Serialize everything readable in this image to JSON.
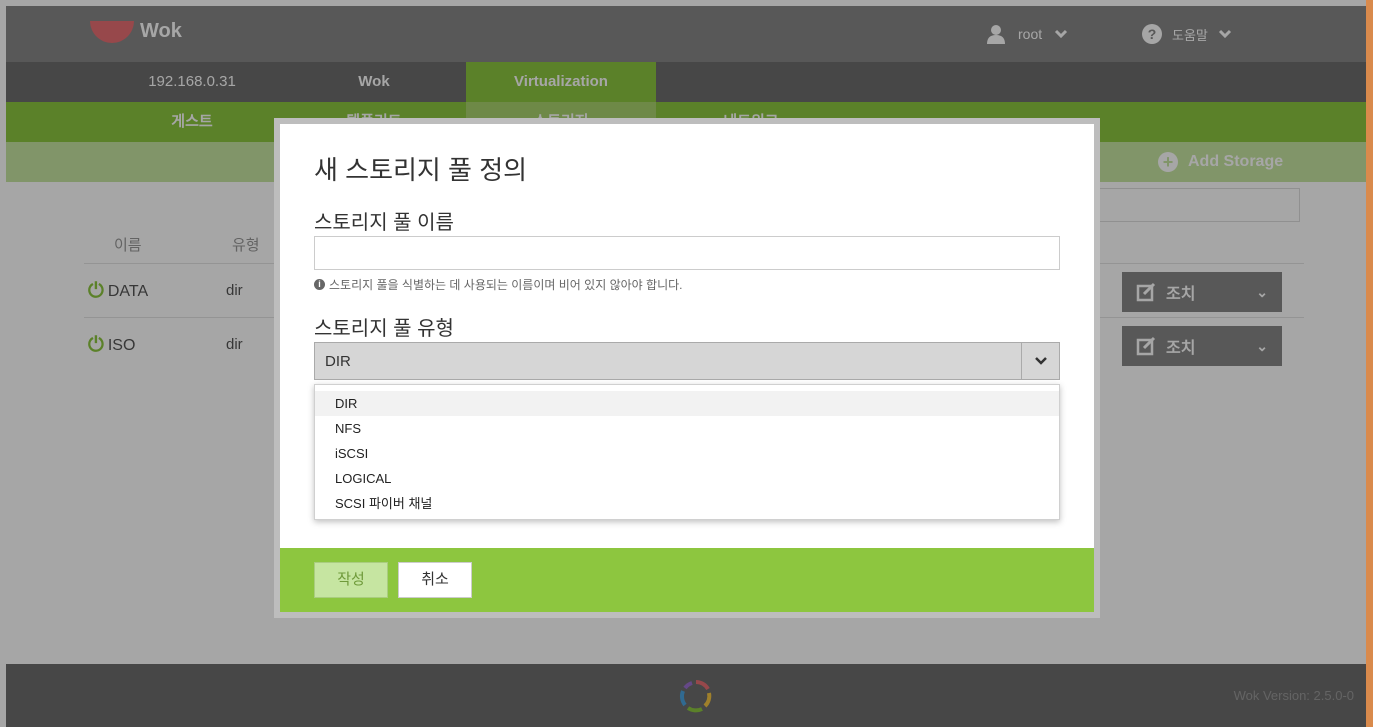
{
  "app": {
    "logo_text": "Wok"
  },
  "topbar": {
    "user": "root",
    "help": "도움말"
  },
  "host_tabs": [
    {
      "label": "192.168.0.31"
    },
    {
      "label": "Wok"
    },
    {
      "label": "Virtualization"
    }
  ],
  "sub_tabs": [
    {
      "label": "게스트"
    },
    {
      "label": "템플리트"
    },
    {
      "label": "스토리지"
    },
    {
      "label": "네트워크"
    }
  ],
  "actionbar": {
    "add_storage": "Add Storage"
  },
  "table": {
    "headers": [
      "이름",
      "유형"
    ],
    "rows": [
      {
        "name": "DATA",
        "type": "dir",
        "action": "조치"
      },
      {
        "name": "ISO",
        "type": "dir",
        "action": "조치"
      }
    ]
  },
  "modal": {
    "title": "새 스토리지 풀 정의",
    "name_label": "스토리지 풀 이름",
    "name_value": "",
    "name_hint": "스토리지 풀을 식별하는 데 사용되는 이름이며 비어 있지 않아야 합니다.",
    "type_label": "스토리지 풀 유형",
    "type_selected": "DIR",
    "type_options": [
      "DIR",
      "NFS",
      "iSCSI",
      "LOGICAL",
      "SCSI 파이버 채널"
    ],
    "create_label": "작성",
    "cancel_label": "취소"
  },
  "footer": {
    "version": "Wok Version: 2.5.0-0"
  },
  "colors": {
    "accent": "#8dc63f",
    "header": "#878787",
    "logo": "#e86f73"
  }
}
